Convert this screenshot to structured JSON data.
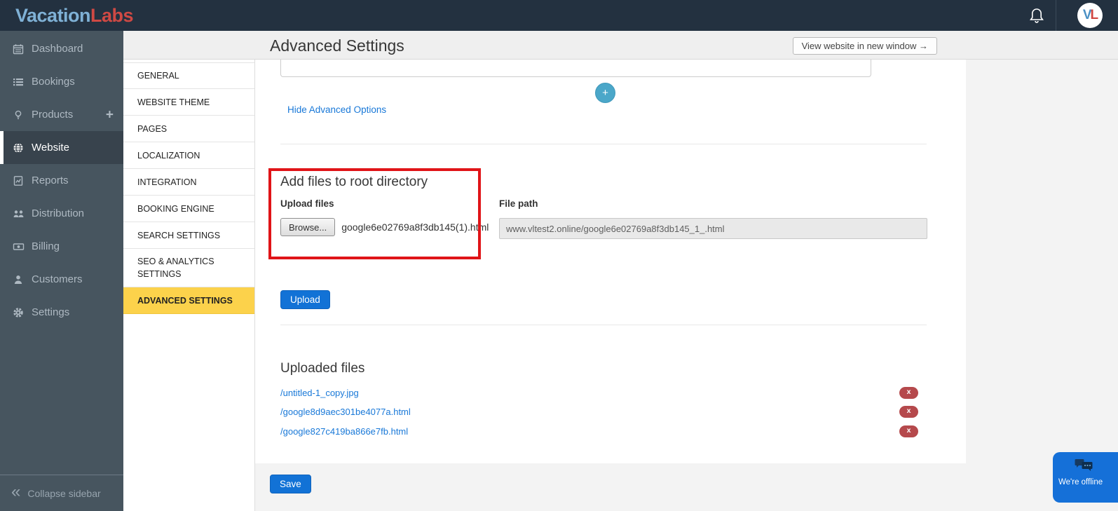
{
  "topbar": {
    "logo": {
      "part1": "Vacation",
      "part2": "Labs"
    },
    "avatar": {
      "part1": "V",
      "part2": "L"
    }
  },
  "icons": {
    "plus": "+",
    "collapse_chevrons": "«"
  },
  "sidebar": {
    "items": [
      {
        "label": "Dashboard",
        "icon": "calendar-icon"
      },
      {
        "label": "Bookings",
        "icon": "bookings-list-icon"
      },
      {
        "label": "Products",
        "icon": "lightbulb-icon",
        "has_plus": true
      },
      {
        "label": "Website",
        "icon": "globe-icon",
        "active": true
      },
      {
        "label": "Reports",
        "icon": "report-icon"
      },
      {
        "label": "Distribution",
        "icon": "distribution-users-icon"
      },
      {
        "label": "Billing",
        "icon": "billing-icon"
      },
      {
        "label": "Customers",
        "icon": "customer-icon"
      },
      {
        "label": "Settings",
        "icon": "gear-icon"
      }
    ],
    "collapse_label": "Collapse sidebar"
  },
  "settings_nav": {
    "items": [
      {
        "label": "GENERAL"
      },
      {
        "label": "WEBSITE THEME"
      },
      {
        "label": "PAGES"
      },
      {
        "label": "LOCALIZATION"
      },
      {
        "label": "INTEGRATION"
      },
      {
        "label": "BOOKING ENGINE"
      },
      {
        "label": "SEARCH SETTINGS"
      },
      {
        "label": "SEO & ANALYTICS SETTINGS"
      },
      {
        "label": "ADVANCED SETTINGS",
        "active": true
      }
    ]
  },
  "header": {
    "title": "Advanced Settings",
    "view_website_label": "View website in new window →"
  },
  "main": {
    "add_option_label": "+",
    "hide_advanced_label": "Hide Advanced Options",
    "add_files": {
      "heading": "Add files to root directory",
      "upload_files_label": "Upload files",
      "browse_label": "Browse...",
      "selected_filename": "google6e02769a8f3db145(1).html",
      "file_path_label": "File path",
      "file_path_value": "www.vltest2.online/google6e02769a8f3db145_1_.html"
    },
    "upload_button_label": "Upload",
    "uploaded": {
      "heading": "Uploaded files",
      "files": [
        {
          "name": "/untitled-1_copy.jpg"
        },
        {
          "name": "/google8d9aec301be4077a.html"
        },
        {
          "name": "/google827c419ba866e7fb.html"
        }
      ],
      "delete_label": "x"
    },
    "save_button_label": "Save"
  },
  "chat_widget": {
    "status": "We're offline"
  },
  "colors": {
    "topbar_bg": "#233140",
    "sidebar_bg": "#47555f",
    "active_tab_yellow": "#fcd24b",
    "primary_button_blue": "#1272d6",
    "link_blue": "#1878d8",
    "highlight_red": "#e01418",
    "delete_red": "#b5494c",
    "plus_teal": "#4ba7c9",
    "chat_blue": "#1570d8"
  }
}
